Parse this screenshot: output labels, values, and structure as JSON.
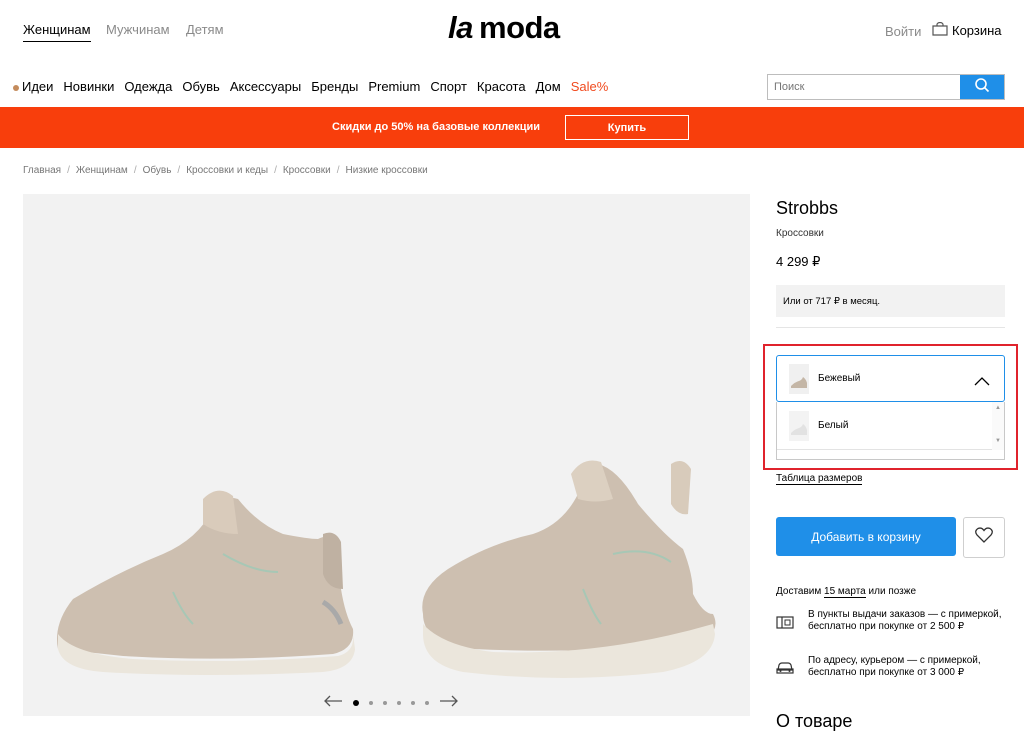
{
  "header": {
    "genders": [
      "Женщинам",
      "Мужчинам",
      "Детям"
    ],
    "logo": "lamoda",
    "login": "Войти",
    "cart": "Корзина"
  },
  "nav": {
    "items": [
      "Идеи",
      "Новинки",
      "Одежда",
      "Обувь",
      "Аксессуары",
      "Бренды",
      "Premium",
      "Спорт",
      "Красота",
      "Дом",
      "Sale%"
    ]
  },
  "search": {
    "placeholder": "Поиск"
  },
  "promo": {
    "text": "Скидки до 50% на базовые коллекции",
    "button": "Купить"
  },
  "breadcrumb": [
    "Главная",
    "Женщинам",
    "Обувь",
    "Кроссовки и кеды",
    "Кроссовки",
    "Низкие кроссовки"
  ],
  "product": {
    "brand": "Strobbs",
    "type": "Кроссовки",
    "price": "4 299 ₽",
    "installment": "Или от 717 ₽ в месяц.",
    "color_selected": "Бежевый",
    "color_options": [
      "Белый"
    ],
    "size_table": "Таблица размеров",
    "add_to_cart": "Добавить в корзину",
    "delivery_prefix": "Доставим",
    "delivery_date": "15 марта",
    "delivery_suffix": "или позже",
    "pickup_text": "В пункты выдачи заказов — с примеркой, бесплатно при покупке от 2 500 ₽",
    "courier_text": "По адресу, курьером — с примеркой, бесплатно при покупке от 3 000 ₽",
    "about": "О товаре"
  },
  "gallery": {
    "slides": 6,
    "active_slide": 1
  },
  "colors": {
    "accent": "#1f8fe8",
    "promo": "#f83e0c",
    "sale": "#f14a1e",
    "highlight": "#e0232c"
  }
}
